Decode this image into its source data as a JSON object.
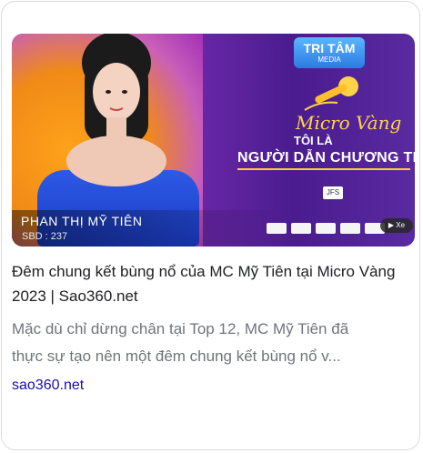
{
  "card": {
    "thumbnail": {
      "person_name": "PHAN THỊ MỸ TIÊN",
      "sbd": "SBD : 237",
      "logo_main": "TRI TÂM",
      "logo_sub": "MEDIA",
      "micro_title": "Micro Vàng",
      "toi_la": "TÔI LÀ",
      "host_text": "NGƯỜI DẪN CHƯƠNG TRÌNH",
      "jfs": "JFS",
      "badge": "Xe",
      "colors": {
        "purple": "#6b27a8",
        "orange": "#f08a17",
        "gold": "#ffd34a",
        "blue": "#1a3ac4"
      }
    },
    "title": "Đêm chung kết bùng nổ của MC Mỹ Tiên tại Micro Vàng 2023 | Sao360.net",
    "description_line1": "Mặc dù chỉ dừng chân tại Top 12, MC Mỹ Tiên đã",
    "description_line2": "thực sự tạo nên một đêm chung kết bùng nổ v...",
    "source": "sao360.net",
    "link_color": "#1a0dab"
  }
}
